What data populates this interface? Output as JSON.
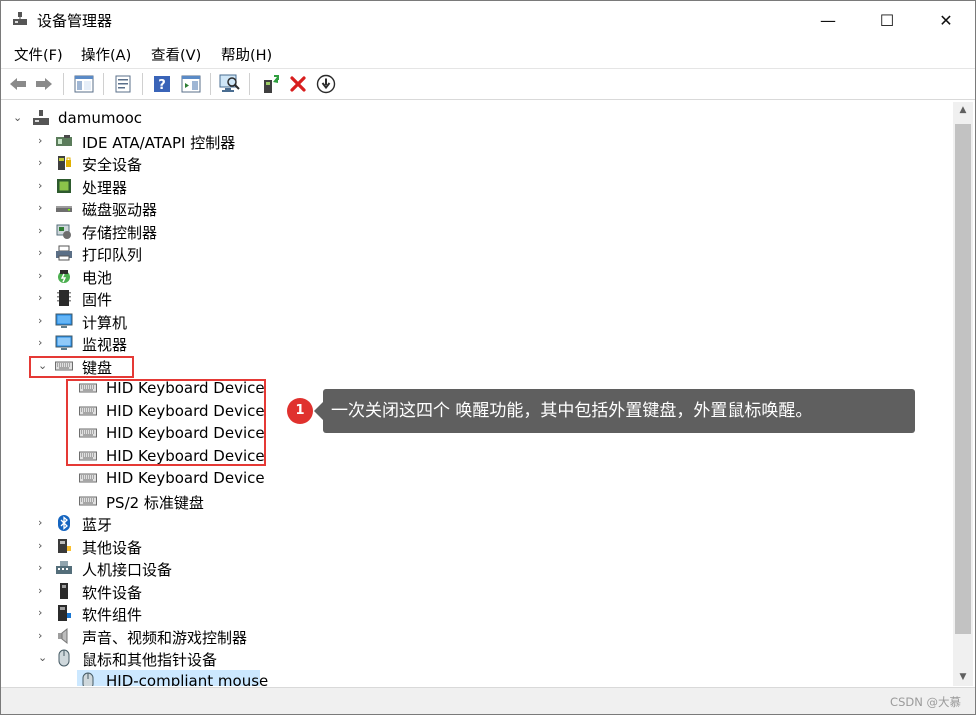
{
  "window": {
    "title": "设备管理器",
    "controls": {
      "minimize": "—",
      "maximize": "☐",
      "close": "✕"
    }
  },
  "menu": [
    "文件(F)",
    "操作(A)",
    "查看(V)",
    "帮助(H)"
  ],
  "toolbar": [
    "back-icon",
    "forward-icon",
    "show-hide-console-tree-icon",
    "properties-icon",
    "help-icon",
    "action-pane-icon",
    "scan-hardware-icon",
    "update-driver-icon",
    "uninstall-icon",
    "disable-device-icon"
  ],
  "tree": {
    "root": "damumooc",
    "categories": [
      {
        "label": "IDE ATA/ATAPI 控制器",
        "icon": "ide-controller-icon"
      },
      {
        "label": "安全设备",
        "icon": "security-device-icon"
      },
      {
        "label": "处理器",
        "icon": "processor-icon"
      },
      {
        "label": "磁盘驱动器",
        "icon": "disk-drive-icon"
      },
      {
        "label": "存储控制器",
        "icon": "storage-controller-icon"
      },
      {
        "label": "打印队列",
        "icon": "printer-icon"
      },
      {
        "label": "电池",
        "icon": "battery-icon"
      },
      {
        "label": "固件",
        "icon": "firmware-icon"
      },
      {
        "label": "计算机",
        "icon": "computer-icon"
      },
      {
        "label": "监视器",
        "icon": "monitor-icon"
      },
      {
        "label": "键盘",
        "icon": "keyboard-icon",
        "expanded": true
      }
    ],
    "keyboards": [
      "HID Keyboard Device",
      "HID Keyboard Device",
      "HID Keyboard Device",
      "HID Keyboard Device",
      "HID Keyboard Device",
      "PS/2 标准键盘"
    ],
    "categories_after": [
      {
        "label": "蓝牙",
        "icon": "bluetooth-icon"
      },
      {
        "label": "其他设备",
        "icon": "other-devices-icon"
      },
      {
        "label": "人机接口设备",
        "icon": "hid-icon"
      },
      {
        "label": "软件设备",
        "icon": "software-device-icon"
      },
      {
        "label": "软件组件",
        "icon": "software-component-icon"
      },
      {
        "label": "声音、视频和游戏控制器",
        "icon": "sound-icon"
      },
      {
        "label": "鼠标和其他指针设备",
        "icon": "mouse-icon",
        "expanded": true
      }
    ],
    "mice": [
      "HID-compliant mouse"
    ]
  },
  "annotation": {
    "badge": "1",
    "text": "一次关闭这四个 唤醒功能，其中包括外置键盘，外置鼠标唤醒。"
  },
  "watermark": "CSDN @大慕",
  "colors": {
    "highlight": "#e53935",
    "callout_bg": "#5f5f5f",
    "badge": "#e0312e",
    "selection": "#cce8ff"
  }
}
